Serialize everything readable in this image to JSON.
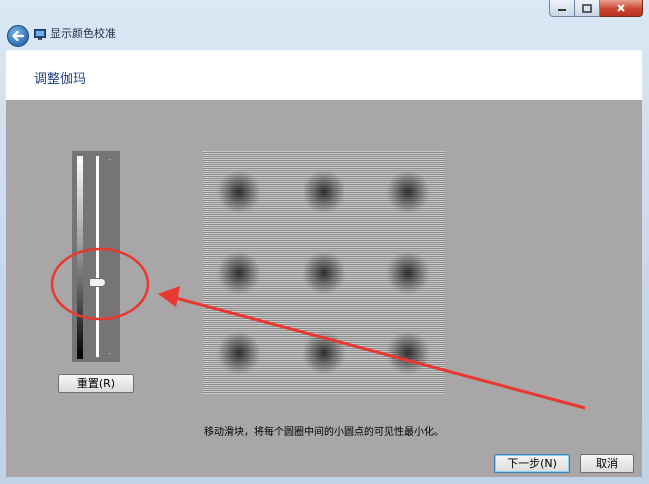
{
  "window": {
    "title": "显示颜色校准",
    "back_icon": "back-arrow-icon",
    "app_icon": "monitor-icon",
    "controls": {
      "minimize": "minimize-icon",
      "maximize": "maximize-icon",
      "close": "close-icon"
    }
  },
  "page": {
    "title": "调整伽玛"
  },
  "gamma_slider": {
    "position": 0.66
  },
  "buttons": {
    "reset": "重置(R)",
    "next": "下一步(N)",
    "cancel": "取消"
  },
  "instruction": "移动滑块，将每个圆圈中间的小圆点的可见性最小化。",
  "colors": {
    "annotation": "#e8382f",
    "title_blue": "#1f3f8a",
    "panel_gray": "#a9a6a7"
  }
}
